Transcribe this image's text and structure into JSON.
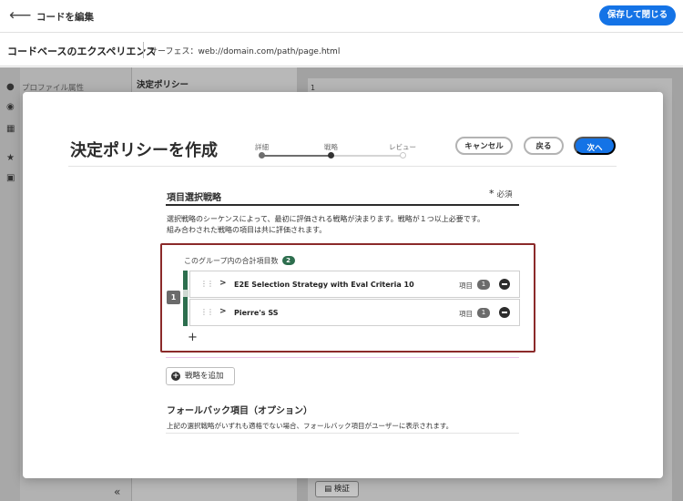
{
  "topbar": {
    "back_icon": "arrow-left-icon",
    "title": "コードを編集",
    "save_close": "保存して閉じる"
  },
  "bar2": {
    "experience_title": "コードベースのエクスペリエンス",
    "surface": "サーフェス：web://domain.com/path/page.html"
  },
  "background": {
    "profile_label": "プロファイル属性",
    "policy_label": "決定ポリシー",
    "canvas_number": "1",
    "verify_label": "検証",
    "collapse_icon": "«"
  },
  "modal": {
    "title": "決定ポリシーを作成",
    "steps": [
      "詳細",
      "戦略",
      "レビュー"
    ],
    "active_step": 2,
    "cancel_label": "キャンセル",
    "back_label": "戻る",
    "next_label": "次へ",
    "section_title": "項目選択戦略",
    "required_star": "*",
    "required_label": "必須",
    "description_line1": "選択戦略のシーケンスによって、最初に評価される戦略が決まります。戦略が１つ以上必要です。",
    "description_line2": "組み合わされた戦略の項目は共に評価されます。",
    "group": {
      "header": "このグループ内の合計項目数",
      "count": "2",
      "number": "1",
      "strategies": [
        {
          "name": "E2E Selection Strategy with Eval Criteria 10",
          "items_label": "項目",
          "items_count": "1"
        },
        {
          "name": "Pierre's SS",
          "items_label": "項目",
          "items_count": "1"
        }
      ],
      "add_symbol": "+"
    },
    "add_strategy_label": "戦略を追加",
    "fallback_title": "フォールバック項目（オプション）",
    "fallback_desc": "上記の選択戦略がいずれも適格でない場合、フォールバック項目がユーザーに表示されます。"
  },
  "colors": {
    "accent": "#1473e6",
    "group_green": "#2d6e4e",
    "highlight_border": "#8b2a2a"
  }
}
